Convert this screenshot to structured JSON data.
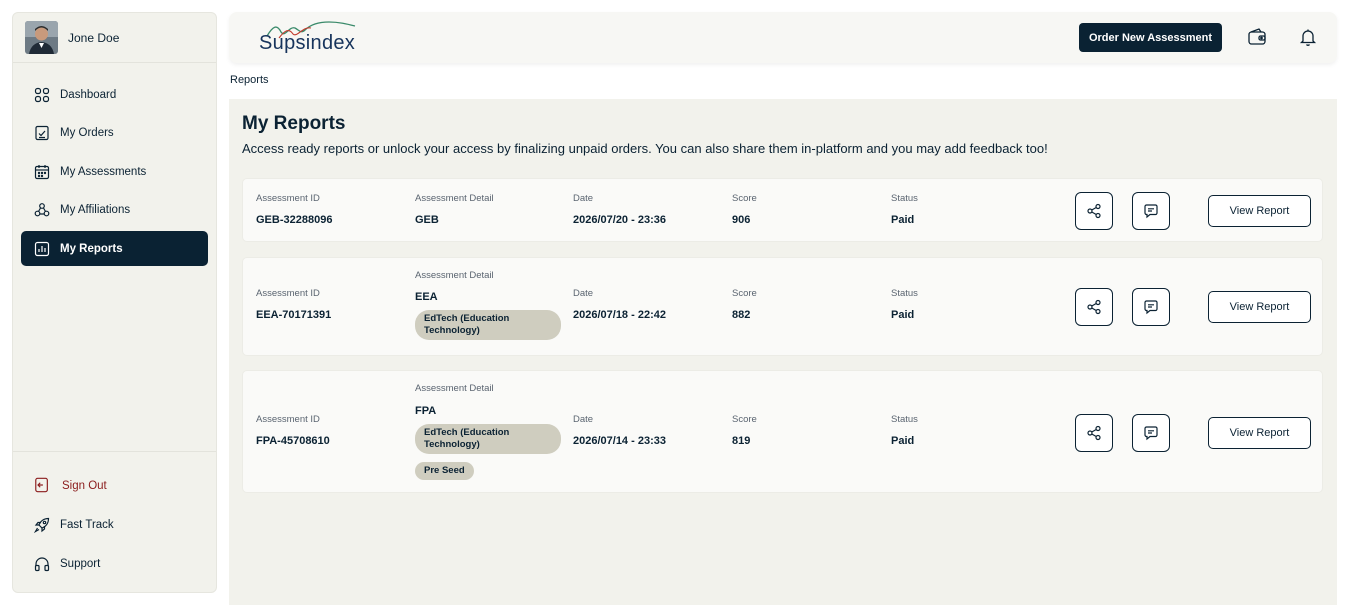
{
  "user": {
    "name": "Jone Doe"
  },
  "nav": {
    "items": [
      {
        "label": "Dashboard",
        "icon": "dashboard-icon"
      },
      {
        "label": "My Orders",
        "icon": "orders-icon"
      },
      {
        "label": "My Assessments",
        "icon": "calendar-icon"
      },
      {
        "label": "My Affiliations",
        "icon": "affiliations-icon"
      },
      {
        "label": "My Reports",
        "icon": "reports-icon",
        "active": true
      }
    ],
    "bottom": [
      {
        "label": "Sign Out",
        "icon": "sign-out-icon"
      },
      {
        "label": "Fast Track",
        "icon": "rocket-icon"
      },
      {
        "label": "Support",
        "icon": "headphones-icon"
      }
    ]
  },
  "header": {
    "logo_text": "Supsindex",
    "order_button": "Order New Assessment",
    "wallet_icon": "wallet-icon",
    "bell_icon": "bell-icon"
  },
  "breadcrumb": "Reports",
  "page": {
    "title": "My Reports",
    "subtitle": "Access ready reports or unlock your access by finalizing unpaid orders. You can also share them in-platform and you may add feedback too!"
  },
  "columns": {
    "id": "Assessment ID",
    "detail": "Assessment Detail",
    "date": "Date",
    "score": "Score",
    "status": "Status"
  },
  "reports": [
    {
      "id": "GEB-32288096",
      "detail": "GEB",
      "tags": [],
      "date": "2026/07/20 - 23:36",
      "score": "906",
      "status": "Paid",
      "view": "View Report"
    },
    {
      "id": "EEA-70171391",
      "detail": "EEA",
      "tags": [
        "EdTech (Education Technology)"
      ],
      "date": "2026/07/18 - 22:42",
      "score": "882",
      "status": "Paid",
      "view": "View Report"
    },
    {
      "id": "FPA-45708610",
      "detail": "FPA",
      "tags": [
        "EdTech (Education Technology)",
        "Pre Seed"
      ],
      "date": "2026/07/14 - 23:33",
      "score": "819",
      "status": "Paid",
      "view": "View Report"
    }
  ],
  "colors": {
    "primary": "#0a2233",
    "background": "#f2f2ec",
    "tag": "#cfcdbf",
    "signout": "#8b1c1c"
  }
}
